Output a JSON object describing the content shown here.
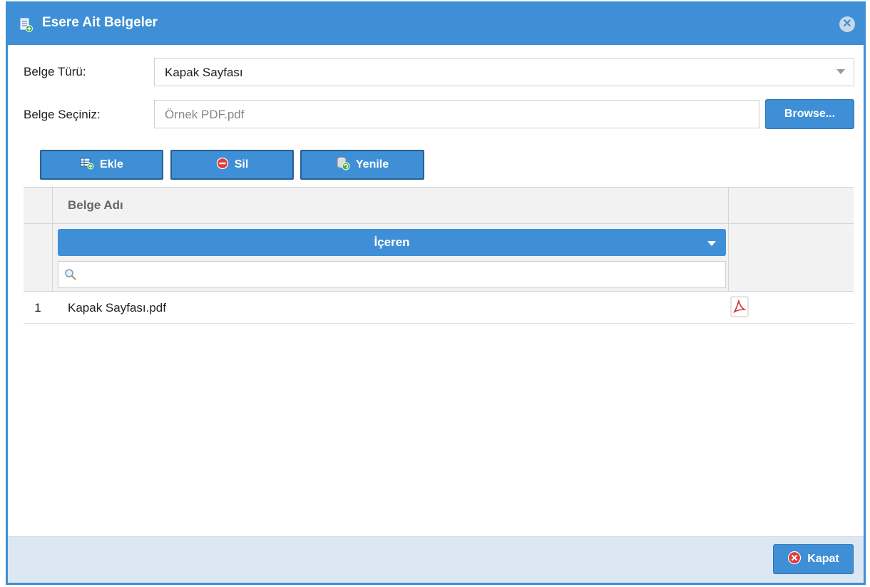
{
  "window": {
    "title": "Esere Ait Belgeler",
    "icon": "document-stack-icon",
    "close_icon": "close-circle-icon"
  },
  "form": {
    "belge_turu_label": "Belge Türü:",
    "belge_turu_value": "Kapak Sayfası",
    "belge_seciniz_label": "Belge Seçiniz:",
    "belge_seciniz_value": "Örnek PDF.pdf",
    "browse_label": "Browse..."
  },
  "toolbar": {
    "ekle_label": "Ekle",
    "ekle_icon": "grid-add-icon",
    "sil_label": "Sil",
    "sil_icon": "minus-circle-icon",
    "yenile_label": "Yenile",
    "yenile_icon": "database-refresh-icon"
  },
  "grid": {
    "column_header": "Belge Adı",
    "filter_mode": "İçeren",
    "filter_icon": "search-icon",
    "rows": [
      {
        "num": "1",
        "name": "Kapak Sayfası.pdf",
        "icon": "pdf-icon"
      }
    ]
  },
  "footer": {
    "kapat_label": "Kapat",
    "kapat_icon": "close-circle-red-icon"
  },
  "colors": {
    "accent": "#3e8fd6",
    "footer_bg": "#dce7f3",
    "grid_header_bg": "#f2f2f2",
    "danger": "#e03c3c"
  }
}
